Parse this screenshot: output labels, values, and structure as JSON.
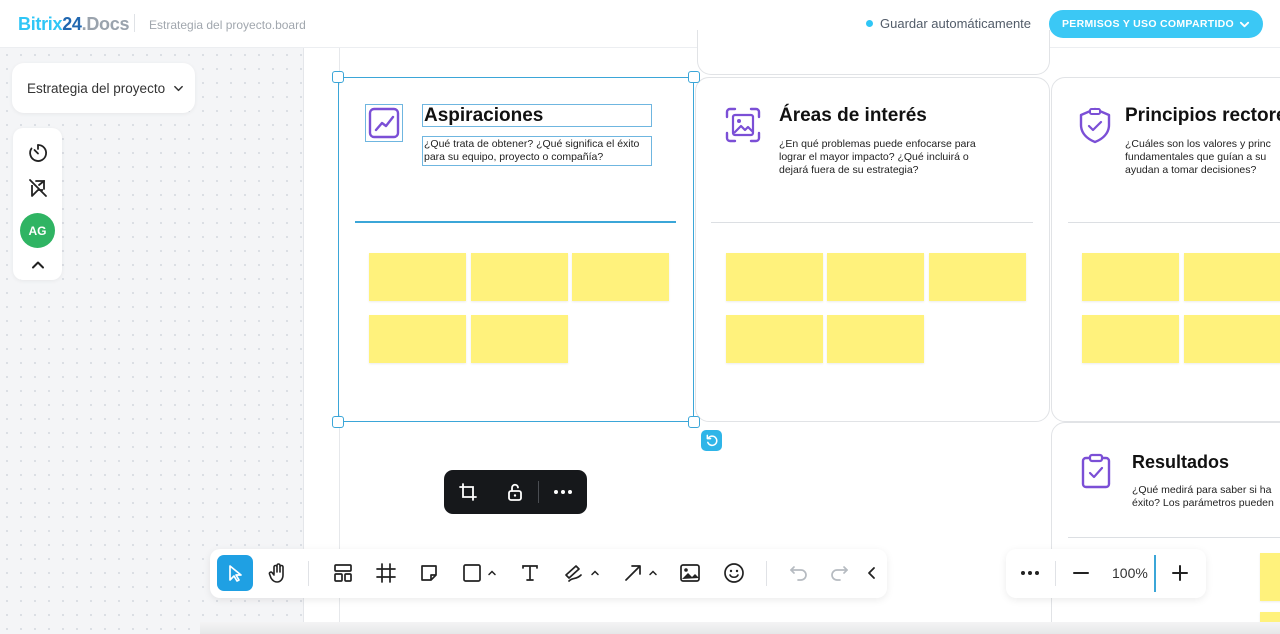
{
  "header": {
    "logo_part1": "Bitrix",
    "logo_part2": "24",
    "logo_part3": ".Docs",
    "doc_name": "Estrategia del proyecto.board",
    "autosave_label": "Guardar automáticamente",
    "share_label": "PERMISOS Y USO COMPARTIDO"
  },
  "board_selector": {
    "label": "Estrategia del proyecto"
  },
  "side_tools": {
    "items": [
      "timer-icon",
      "hide-pointer-icon",
      "avatar",
      "collapse-icon"
    ],
    "avatar_initials": "AG"
  },
  "frames": [
    {
      "title": "Aspiraciones",
      "description": "¿Qué trata de obtener? ¿Qué significa el éxito para su equipo, proyecto o compañía?",
      "icon": "chart-icon",
      "sticky_count": 5
    },
    {
      "title": "Áreas de interés",
      "description": "¿En qué problemas puede enfocarse para lograr el mayor impacto? ¿Qué incluirá o dejará fuera de su estrategia?",
      "icon": "image-focus-icon",
      "sticky_count": 5
    },
    {
      "title": "Principios rectore",
      "description": "¿Cuáles son los valores y princ fundamentales que guían a su ayudan a tomar decisiones?",
      "icon": "shield-icon",
      "sticky_count": 4
    },
    {
      "title": "Resultados",
      "description": "¿Qué medirá para saber si ha éxito? Los parámetros pueden",
      "icon": "clipboard-check-icon"
    }
  ],
  "context_menu": {
    "items": [
      "crop-frame-icon",
      "unlock-icon",
      "more-icon"
    ]
  },
  "toolbar": {
    "tools": [
      "select",
      "hand",
      "template",
      "frame",
      "sticky-note",
      "shape",
      "text",
      "pen",
      "arrow",
      "image",
      "emoji",
      "undo",
      "redo",
      "collapse"
    ],
    "active_tool": "select"
  },
  "zoom": {
    "value": "100%"
  },
  "colors": {
    "accent": "#2fc6f6",
    "selection": "#3ba6d8",
    "sticky": "#fff27c",
    "icon_purple": "#7b4fd6",
    "avatar": "#2fb463"
  }
}
